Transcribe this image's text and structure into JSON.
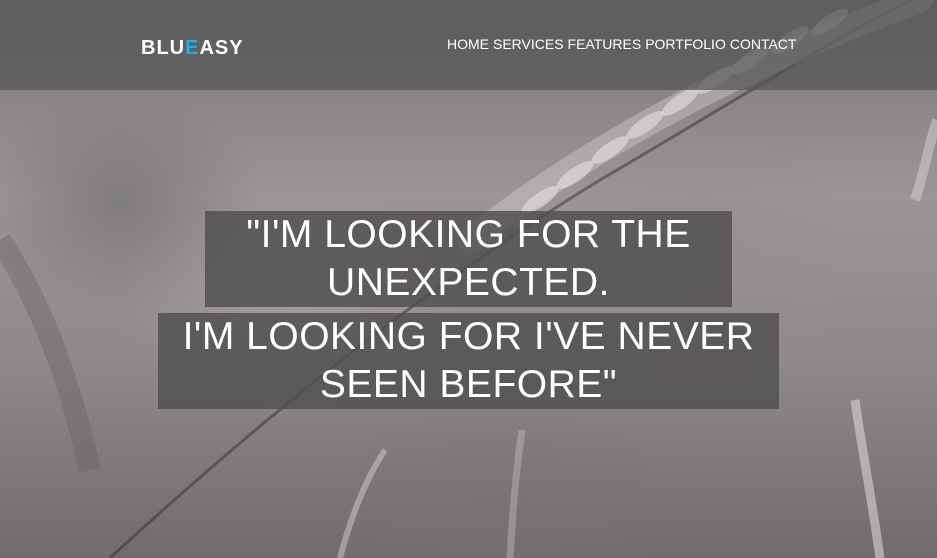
{
  "brand": {
    "part1": "BLU",
    "part2": "E",
    "part3": "ASY",
    "accent_color": "#29a9e8"
  },
  "nav": {
    "items": [
      {
        "label": "HOME"
      },
      {
        "label": "SERVICES"
      },
      {
        "label": "FEATURES"
      },
      {
        "label": "PORTFOLIO"
      },
      {
        "label": "CONTACT"
      }
    ]
  },
  "hero": {
    "quote_line1": "\"I'M LOOKING FOR THE UNEXPECTED.",
    "quote_line2": "I'M LOOKING FOR I'VE NEVER SEEN BEFORE\""
  }
}
